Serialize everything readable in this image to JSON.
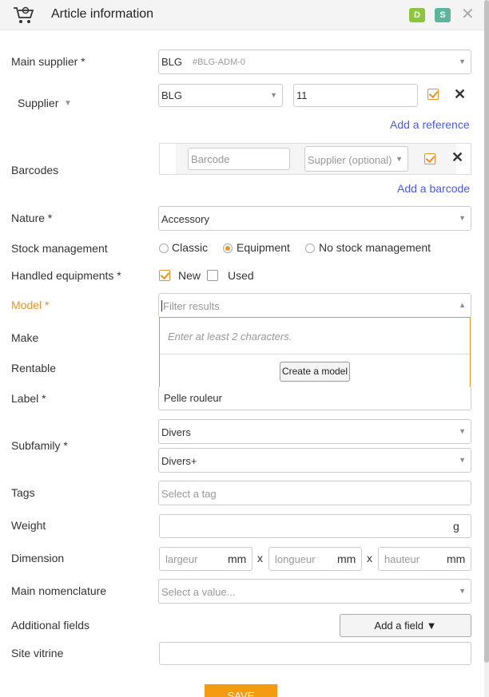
{
  "header": {
    "title": "Article information",
    "badge_d": "D",
    "badge_s": "S",
    "close": "✕",
    "icon": "cart-gear-icon"
  },
  "labels": {
    "main_supplier": "Main supplier *",
    "supplier": "Supplier",
    "barcodes": "Barcodes",
    "nature": "Nature *",
    "stock_management": "Stock management",
    "handled_equipments": "Handled equipments *",
    "model": "Model *",
    "make": "Make",
    "rentable": "Rentable",
    "label": "Label *",
    "subfamily": "Subfamily *",
    "tags": "Tags",
    "weight": "Weight",
    "dimension": "Dimension",
    "main_nomenclature": "Main nomenclature",
    "additional_fields": "Additional fields",
    "site_vitrine": "Site vitrine"
  },
  "main_supplier": {
    "name": "BLG",
    "code": "#BLG-ADM-0"
  },
  "supplier_row": {
    "supplier": "BLG",
    "reference": "11",
    "checked": true
  },
  "add_reference": "Add a reference",
  "barcode_row": {
    "barcode_placeholder": "Barcode",
    "supplier_placeholder": "Supplier (optional)",
    "checked": true
  },
  "add_barcode": "Add a barcode",
  "nature": "Accessory",
  "stock_options": [
    {
      "label": "Classic",
      "selected": false
    },
    {
      "label": "Equipment",
      "selected": true
    },
    {
      "label": "No stock management",
      "selected": false
    }
  ],
  "handled": [
    {
      "label": "New",
      "checked": true
    },
    {
      "label": "Used",
      "checked": false
    }
  ],
  "model": {
    "filter_placeholder": "Filter results",
    "hint": "Enter at least 2 characters.",
    "create_button": "Create a model"
  },
  "label_value": "Pelle rouleur",
  "subfamily": [
    "Divers",
    "Divers+"
  ],
  "tags_placeholder": "Select a tag",
  "weight_unit": "g",
  "dimension": {
    "width_placeholder": "largeur",
    "length_placeholder": "longueur",
    "height_placeholder": "hauteur",
    "unit": "mm",
    "separator": "x"
  },
  "nomenclature_placeholder": "Select a value...",
  "add_field_button": "Add a field ▼",
  "save_button": "SAVE",
  "colors": {
    "accent": "#e6932a",
    "link": "#4a5bdc",
    "badge_d": "#8cc63f",
    "badge_s": "#5fb59b",
    "save": "#f39c12"
  }
}
